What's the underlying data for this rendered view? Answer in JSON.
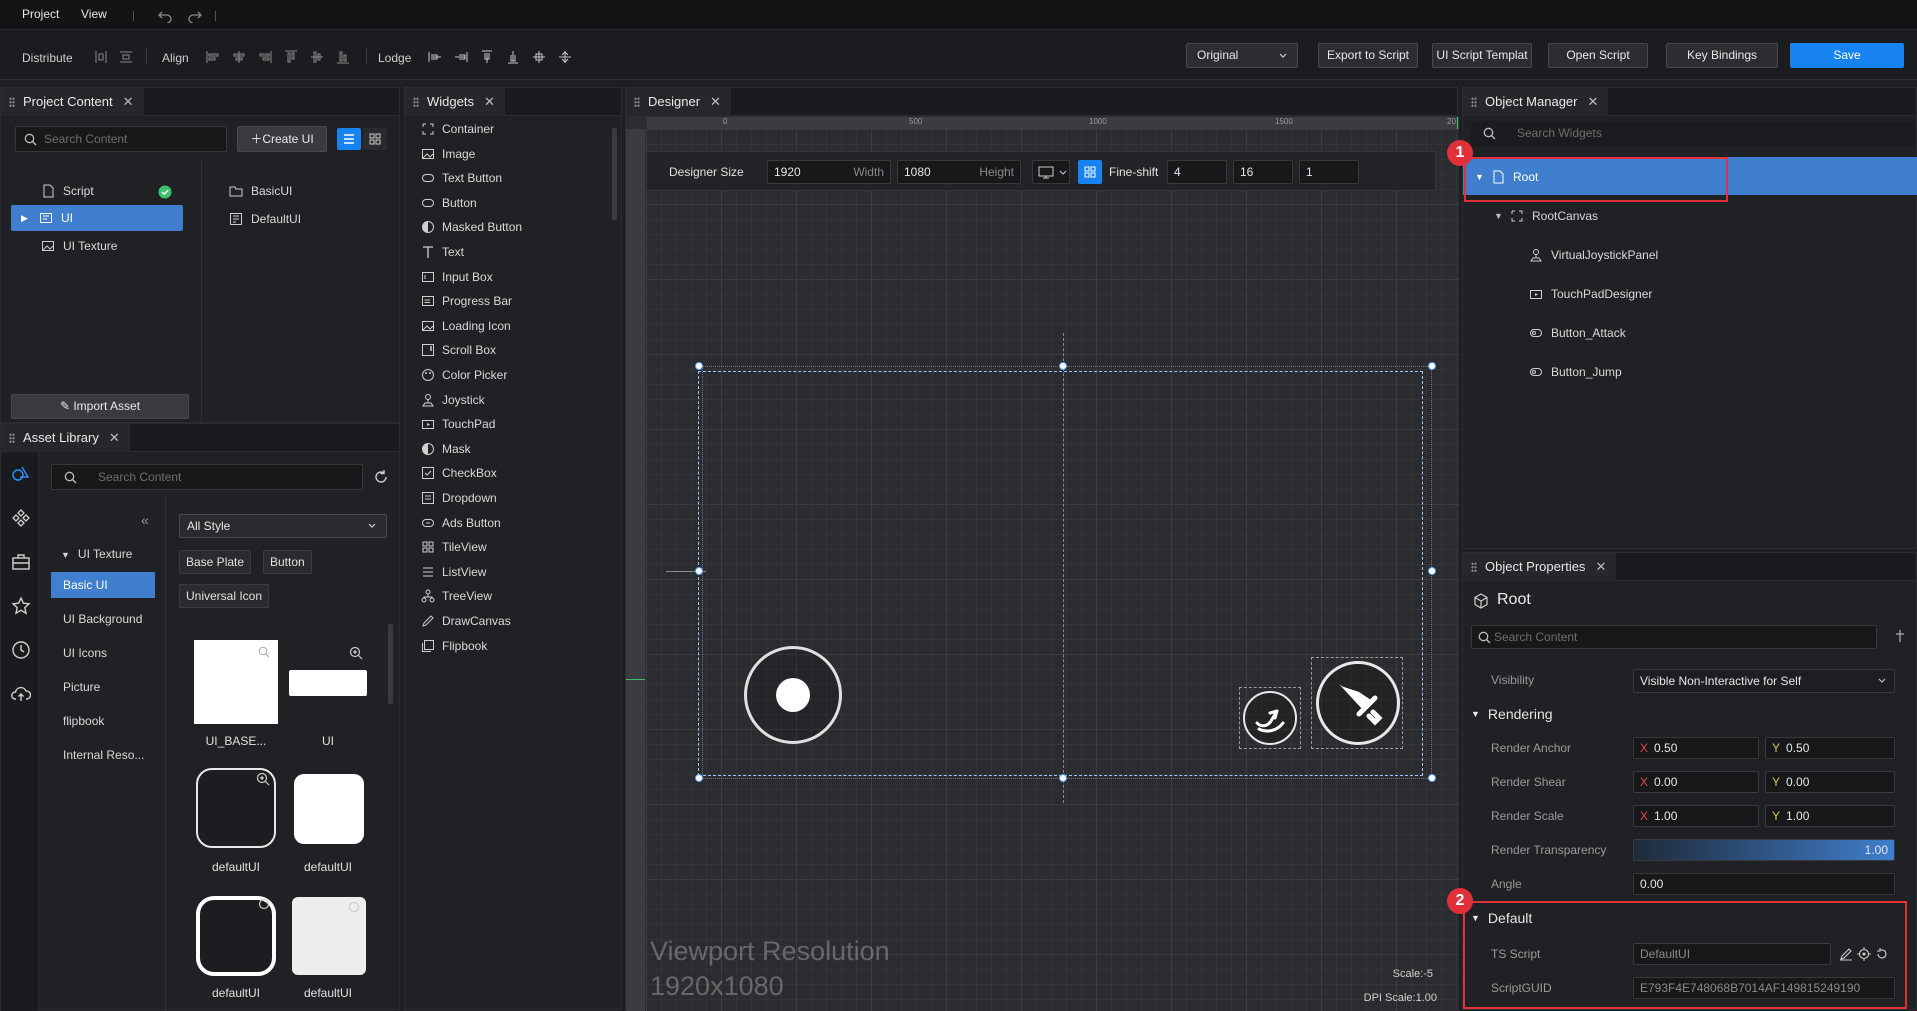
{
  "menu": {
    "project": "Project",
    "view": "View"
  },
  "toolbar": {
    "distribute": "Distribute",
    "align": "Align",
    "lodge": "Lodge",
    "resolution_select": "Original",
    "export_script": "Export to Script",
    "ui_script_template": "UI Script Templat",
    "open_script": "Open Script",
    "key_bindings": "Key Bindings",
    "save": "Save"
  },
  "project_content": {
    "title": "Project Content",
    "search_placeholder": "Search Content",
    "create_ui": "Create UI",
    "tree": [
      {
        "label": "Script",
        "icon": "document-icon",
        "status": "check"
      },
      {
        "label": "UI",
        "icon": "ui-folder-icon",
        "selected": true
      },
      {
        "label": "UI Texture",
        "icon": "image-icon"
      }
    ],
    "files": [
      {
        "label": "BasicUI",
        "icon": "folder-icon"
      },
      {
        "label": "DefaultUI",
        "icon": "ui-file-icon"
      }
    ],
    "import_asset": "Import Asset"
  },
  "asset_library": {
    "title": "Asset Library",
    "search_placeholder": "Search Content",
    "style_select": "All Style",
    "tree_root": "UI Texture",
    "categories": [
      "Basic UI",
      "UI Background",
      "UI Icons",
      "Picture",
      "flipbook",
      "Internal Reso..."
    ],
    "chips": [
      "Base Plate",
      "Button",
      "Universal Icon"
    ],
    "thumbnails": [
      "UI_BASE...",
      "UI",
      "defaultUI",
      "defaultUI",
      "defaultUI",
      "defaultUI"
    ]
  },
  "widgets": {
    "title": "Widgets",
    "items": [
      {
        "label": "Container",
        "icon": "container-icon"
      },
      {
        "label": "Image",
        "icon": "image-icon"
      },
      {
        "label": "Text Button",
        "icon": "text-button-icon"
      },
      {
        "label": "Button",
        "icon": "button-icon"
      },
      {
        "label": "Masked Button",
        "icon": "masked-button-icon"
      },
      {
        "label": "Text",
        "icon": "text-icon"
      },
      {
        "label": "Input Box",
        "icon": "input-box-icon"
      },
      {
        "label": "Progress Bar",
        "icon": "progress-bar-icon"
      },
      {
        "label": "Loading Icon",
        "icon": "loading-icon"
      },
      {
        "label": "Scroll Box",
        "icon": "scroll-box-icon"
      },
      {
        "label": "Color Picker",
        "icon": "color-picker-icon"
      },
      {
        "label": "Joystick",
        "icon": "joystick-icon"
      },
      {
        "label": "TouchPad",
        "icon": "touchpad-icon"
      },
      {
        "label": "Mask",
        "icon": "mask-icon"
      },
      {
        "label": "CheckBox",
        "icon": "checkbox-icon"
      },
      {
        "label": "Dropdown",
        "icon": "dropdown-icon"
      },
      {
        "label": "Ads Button",
        "icon": "ads-button-icon"
      },
      {
        "label": "TileView",
        "icon": "tileview-icon"
      },
      {
        "label": "ListView",
        "icon": "listview-icon"
      },
      {
        "label": "TreeView",
        "icon": "treeview-icon"
      },
      {
        "label": "DrawCanvas",
        "icon": "drawcanvas-icon"
      },
      {
        "label": "Flipbook",
        "icon": "flipbook-icon"
      }
    ]
  },
  "designer": {
    "title": "Designer",
    "size_label": "Designer Size",
    "width_value": "1920",
    "width_label": "Width",
    "height_value": "1080",
    "height_label": "Height",
    "fine_shift_label": "Fine-shift",
    "fine_shift_value": "4",
    "grid_value": "16",
    "step_value": "1",
    "ruler_ticks": [
      "0",
      "500",
      "1000",
      "1500",
      "20"
    ],
    "viewport_label": "Viewport Resolution",
    "viewport_value": "1920x1080",
    "scale": "Scale:-5",
    "dpi_scale": "DPI Scale:1.00"
  },
  "object_manager": {
    "title": "Object Manager",
    "search_placeholder": "Search Widgets",
    "tree": [
      {
        "label": "Root",
        "icon": "document-icon",
        "level": 0,
        "selected": true
      },
      {
        "label": "RootCanvas",
        "icon": "canvas-icon",
        "level": 1
      },
      {
        "label": "VirtualJoystickPanel",
        "icon": "joystick-icon",
        "level": 2
      },
      {
        "label": "TouchPadDesigner",
        "icon": "touchpad-icon",
        "level": 2
      },
      {
        "label": "Button_Attack",
        "icon": "button-icon",
        "level": 2
      },
      {
        "label": "Button_Jump",
        "icon": "button-icon",
        "level": 2
      }
    ]
  },
  "object_properties": {
    "title": "Object Properties",
    "object_name": "Root",
    "search_placeholder": "Search Content",
    "visibility_label": "Visibility",
    "visibility_value": "Visible Non-Interactive for Self",
    "rendering_section": "Rendering",
    "render_anchor_label": "Render Anchor",
    "render_anchor": {
      "x": "0.50",
      "y": "0.50"
    },
    "render_shear_label": "Render Shear",
    "render_shear": {
      "x": "0.00",
      "y": "0.00"
    },
    "render_scale_label": "Render Scale",
    "render_scale": {
      "x": "1.00",
      "y": "1.00"
    },
    "render_transparency_label": "Render Transparency",
    "render_transparency": "1.00",
    "angle_label": "Angle",
    "angle": "0.00",
    "default_section": "Default",
    "ts_script_label": "TS Script",
    "ts_script": "DefaultUI",
    "script_guid_label": "ScriptGUID",
    "script_guid": "E793F4E748068B7014AF149815249190"
  },
  "annotations": {
    "badge1": "1",
    "badge2": "2"
  },
  "axis_letters": {
    "x": "X",
    "y": "Y"
  },
  "colors": {
    "accent": "#1783f0",
    "selection": "#3f7fce",
    "highlight": "#e0303a"
  }
}
